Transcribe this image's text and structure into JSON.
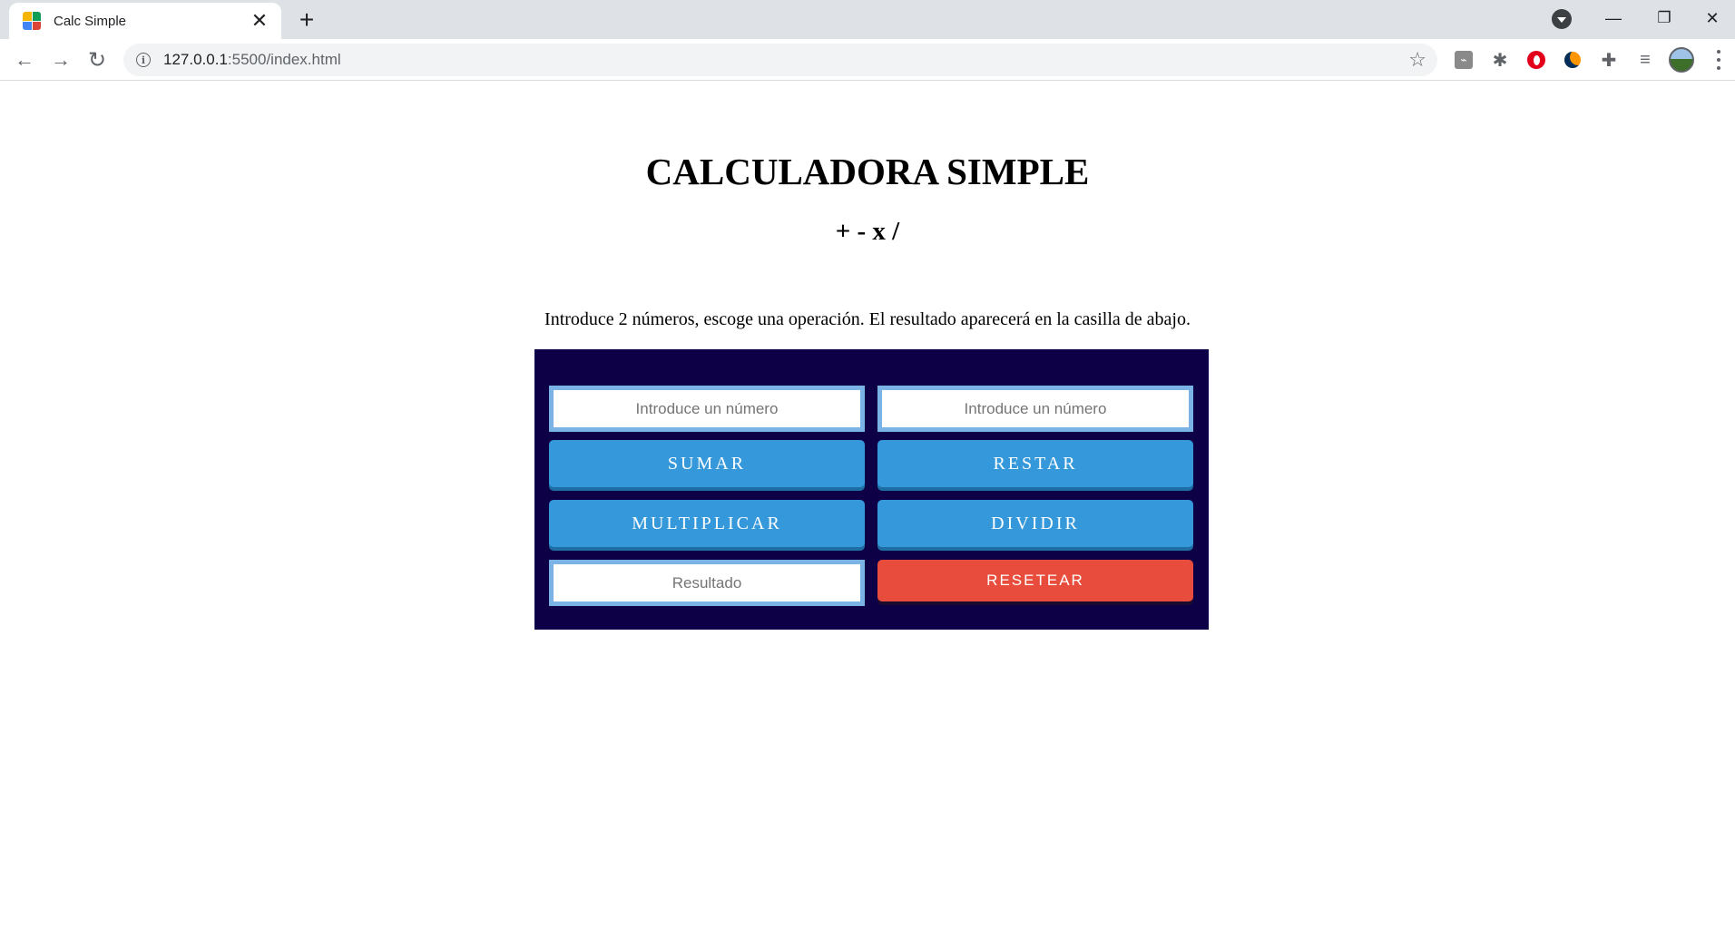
{
  "browser": {
    "tab_title": "Calc Simple",
    "tab_close": "✕",
    "new_tab": "+",
    "url_host": "127.0.0.1",
    "url_path": ":5500/index.html",
    "window_controls": {
      "minimize": "—",
      "restore": "❐",
      "close": "✕"
    },
    "icons": [
      "favicon-calculator-icon",
      "back-arrow-icon",
      "forward-arrow-icon",
      "reload-icon",
      "info-icon",
      "star-icon",
      "pdf-extension-icon",
      "bug-extension-icon",
      "opera-extension-icon",
      "firefox-extension-icon",
      "puzzle-extensions-icon",
      "media-playlist-icon",
      "avatar",
      "more-icon"
    ]
  },
  "page": {
    "title": "CALCULADORA SIMPLE",
    "subtitle": "+ - x /",
    "instructions": "Introduce 2 números, escoge una operación. El resultado aparecerá en la casilla de abajo."
  },
  "calculator": {
    "number1": {
      "value": "",
      "placeholder": "Introduce un número"
    },
    "number2": {
      "value": "",
      "placeholder": "Introduce un número"
    },
    "result": {
      "value": "",
      "placeholder": "Resultado"
    },
    "buttons": {
      "add": "SUMAR",
      "subtract": "RESTAR",
      "multiply": "MULTIPLICAR",
      "divide": "DIVIDIR",
      "reset": "RESETEAR"
    }
  },
  "colors": {
    "panel_bg": "#0d0047",
    "button_blue": "#3498db",
    "button_red": "#e74c3c",
    "input_border": "#7bb3e6"
  }
}
